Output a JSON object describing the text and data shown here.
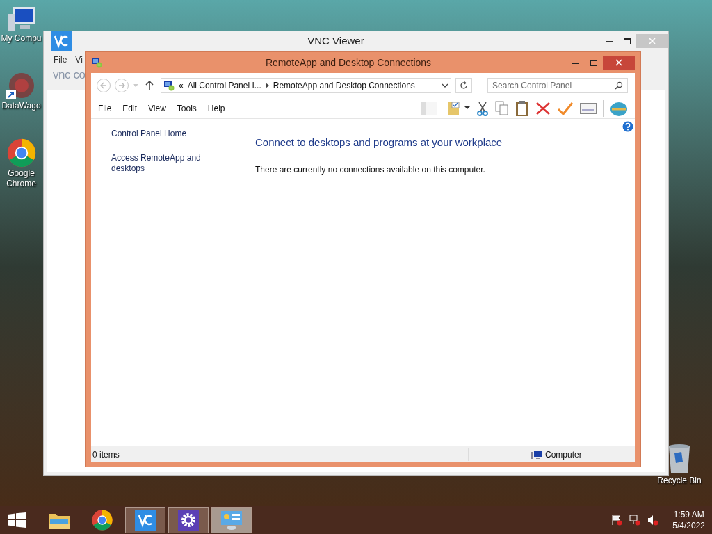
{
  "desktop": {
    "icons": [
      {
        "kind": "computer",
        "label": "My Compu"
      },
      {
        "kind": "datawagon",
        "label": "DataWago"
      },
      {
        "kind": "chrome",
        "label": "Google Chrome"
      }
    ],
    "recycle_bin": {
      "label": "Recycle Bin"
    }
  },
  "vnc_window": {
    "title": "VNC Viewer",
    "menu": [
      "File",
      "Vi"
    ],
    "logo": "vnc co"
  },
  "remoteapp_window": {
    "title": "RemoteApp and Desktop Connections",
    "address": {
      "prefix": "«",
      "segments": [
        "All Control Panel I...",
        "RemoteApp and Desktop Connections"
      ]
    },
    "search": {
      "placeholder": "Search Control Panel"
    },
    "menu": [
      "File",
      "Edit",
      "View",
      "Tools",
      "Help"
    ],
    "sidebar": [
      "Control Panel Home",
      "Access RemoteApp and desktops"
    ],
    "heading": "Connect to desktops and programs at your workplace",
    "message": "There are currently no connections available on this computer.",
    "status_bar": {
      "items": "0 items",
      "location": "Computer"
    }
  },
  "taskbar": {
    "apps": [
      {
        "kind": "explorer",
        "running": false,
        "selected": false
      },
      {
        "kind": "chrome",
        "running": false,
        "selected": false
      },
      {
        "kind": "vnc",
        "running": true,
        "selected": false
      },
      {
        "kind": "settings",
        "running": true,
        "selected": false
      },
      {
        "kind": "control-panel",
        "running": true,
        "selected": true
      }
    ],
    "time": "1:59 AM",
    "date": "5/4/2022"
  }
}
